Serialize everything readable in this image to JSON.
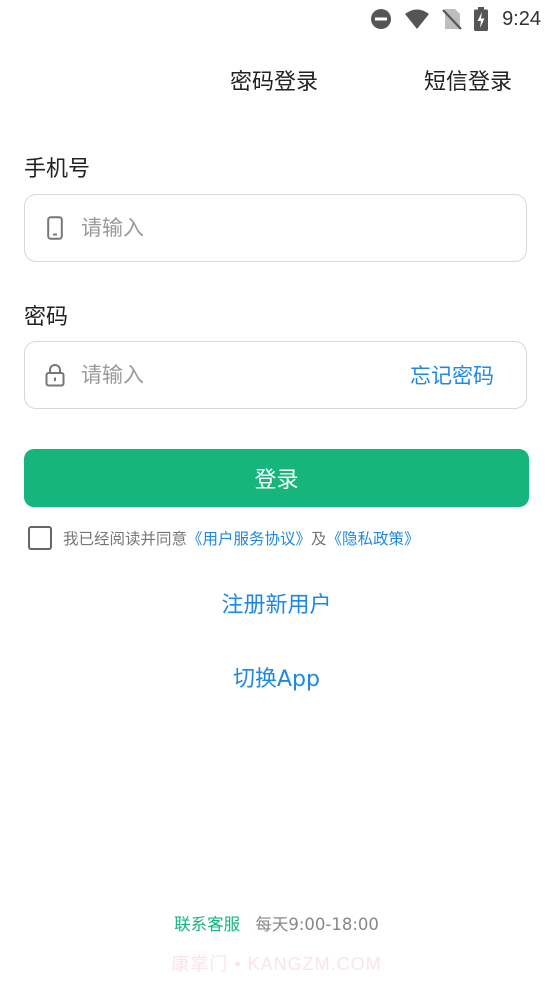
{
  "status_bar": {
    "time": "9:24"
  },
  "tabs": {
    "password_login": "密码登录",
    "sms_login": "短信登录"
  },
  "form": {
    "phone_label": "手机号",
    "phone_placeholder": "请输入",
    "password_label": "密码",
    "password_placeholder": "请输入",
    "forgot_password": "忘记密码",
    "login_button": "登录"
  },
  "agreement": {
    "prefix": "我已经阅读并同意",
    "user_agreement": "《用户服务协议》",
    "and": "及",
    "privacy_policy": "《隐私政策》"
  },
  "links": {
    "register": "注册新用户",
    "switch_app": "切换App"
  },
  "footer": {
    "customer_service": "联系客服",
    "hours": "每天9:00-18:00"
  },
  "watermark": "康掌门 • KANGZM.COM",
  "colors": {
    "accent": "#15b57d",
    "link": "#1e88e5"
  }
}
